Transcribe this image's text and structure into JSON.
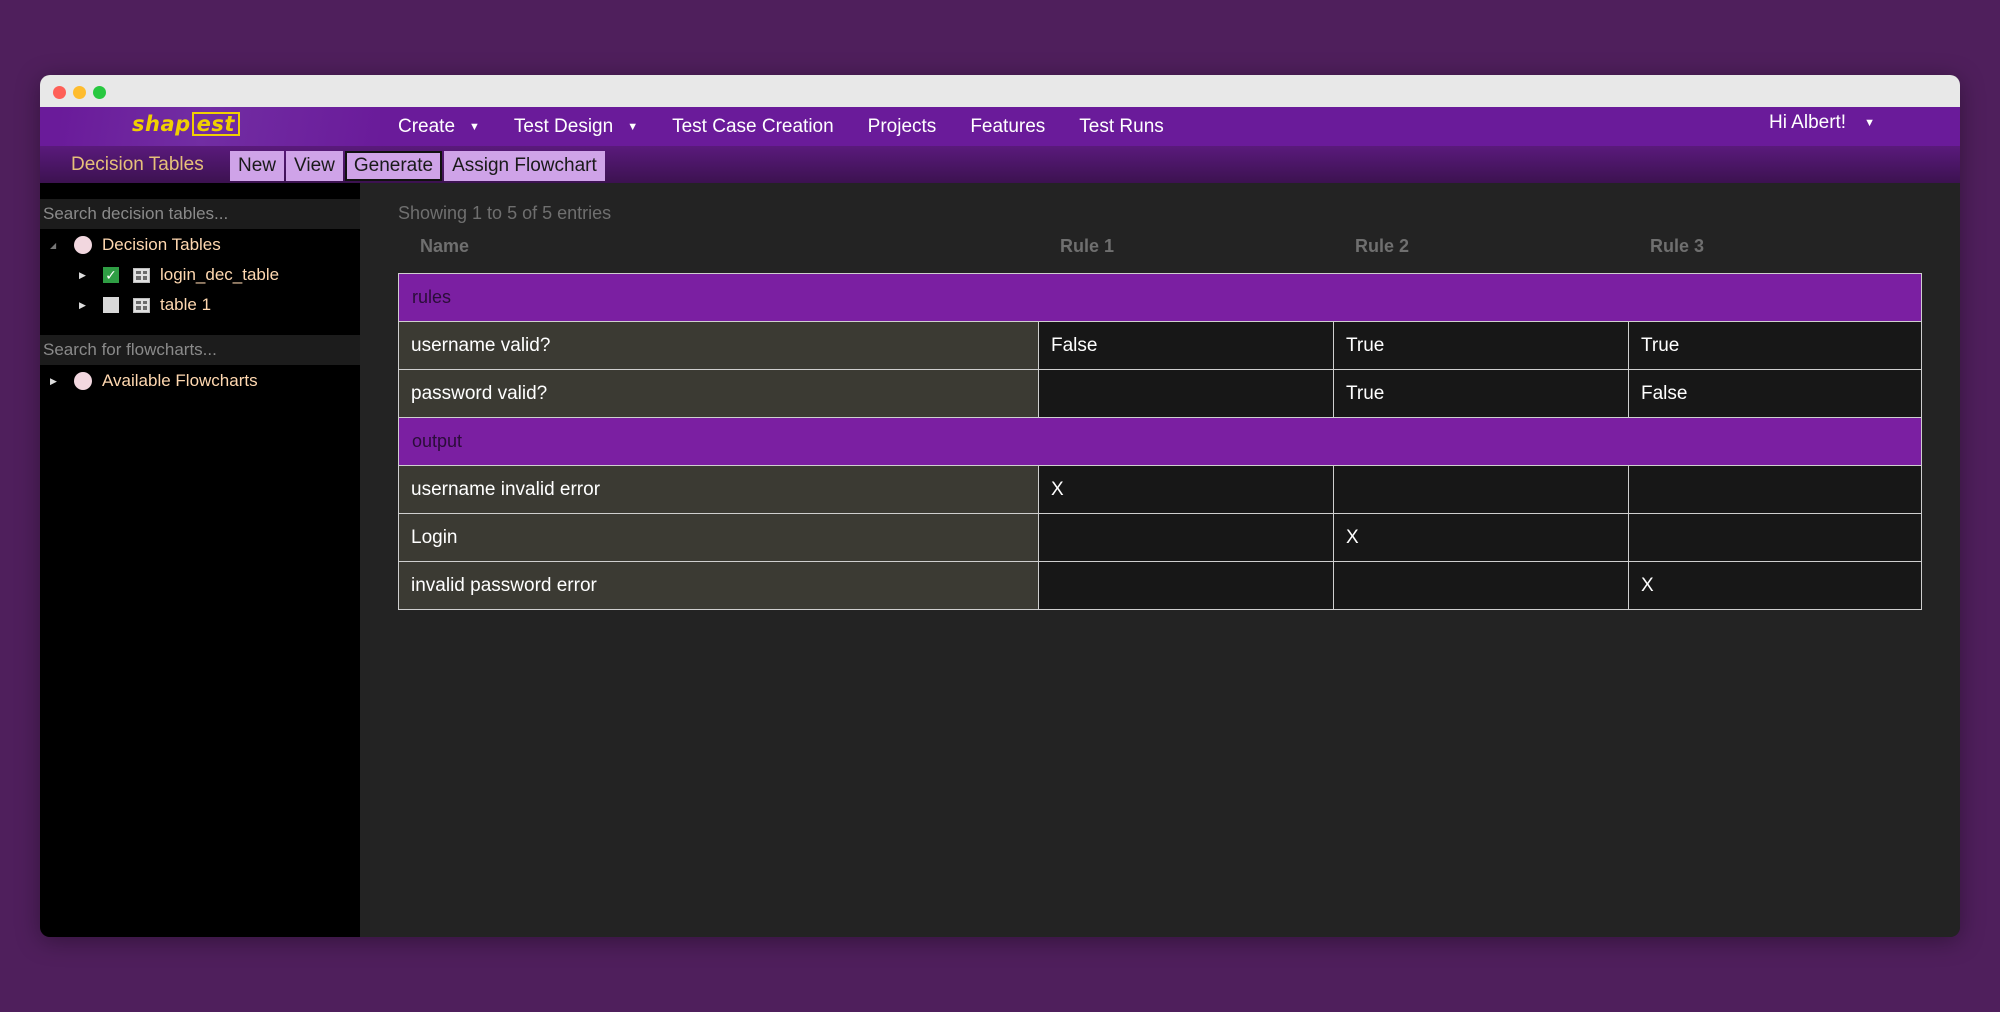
{
  "app": {
    "logo_prefix": "shap",
    "logo_boxed": "est"
  },
  "nav": {
    "items": [
      {
        "label": "Create",
        "has_dropdown": true
      },
      {
        "label": "Test Design",
        "has_dropdown": true
      },
      {
        "label": "Test Case Creation",
        "has_dropdown": false
      },
      {
        "label": "Projects",
        "has_dropdown": false
      },
      {
        "label": "Features",
        "has_dropdown": false
      },
      {
        "label": "Test Runs",
        "has_dropdown": false
      }
    ],
    "user_greeting": "Hi Albert!"
  },
  "subnav": {
    "title": "Decision Tables",
    "buttons": [
      "New",
      "View",
      "Generate",
      "Assign Flowchart"
    ],
    "active_button": "Generate"
  },
  "sidebar": {
    "search_tables_placeholder": "Search decision tables...",
    "tree_root": "Decision Tables",
    "tables": [
      {
        "label": "login_dec_table",
        "checked": true
      },
      {
        "label": "table 1",
        "checked": false
      }
    ],
    "search_flowcharts_placeholder": "Search for flowcharts...",
    "flowcharts_root": "Available Flowcharts"
  },
  "main": {
    "showing_text": "Showing 1 to 5 of 5 entries",
    "columns": [
      "Name",
      "Rule 1",
      "Rule 2",
      "Rule 3"
    ],
    "sections": [
      {
        "label": "rules",
        "rows": [
          {
            "name": "username valid?",
            "values": [
              "False",
              "True",
              "True"
            ]
          },
          {
            "name": "password valid?",
            "values": [
              "",
              "True",
              "False"
            ]
          }
        ]
      },
      {
        "label": "output",
        "rows": [
          {
            "name": "username invalid error",
            "values": [
              "X",
              "",
              ""
            ]
          },
          {
            "name": "Login",
            "values": [
              "",
              "X",
              ""
            ]
          },
          {
            "name": "invalid password error",
            "values": [
              "",
              "",
              "X"
            ]
          }
        ]
      }
    ]
  },
  "colors": {
    "background": "#4f1f5c",
    "nav": "#6a1b9a",
    "section_row": "#7b1fa2",
    "subnav_button": "#cfa3e8",
    "logo": "#f0d000"
  }
}
